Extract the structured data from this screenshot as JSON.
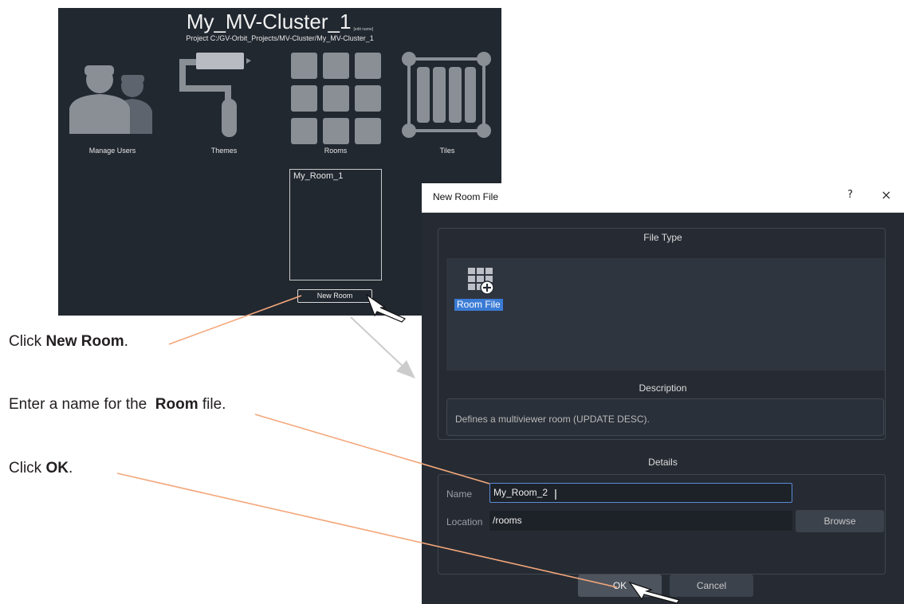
{
  "app": {
    "title": "My_MV-Cluster_1",
    "edit_name": "[edit name]",
    "project_path": "Project C:/GV-Orbit_Projects/MV-Cluster/My_MV-Cluster_1",
    "tiles": [
      {
        "label": "Manage Users",
        "icon": "users-icon"
      },
      {
        "label": "Themes",
        "icon": "paint-roller-icon"
      },
      {
        "label": "Rooms",
        "icon": "grid-icon"
      },
      {
        "label": "Tiles",
        "icon": "tiles-icon"
      }
    ],
    "rooms": [
      "My_Room_1"
    ],
    "new_room_label": "New Room",
    "bg_color": "#222830"
  },
  "instructions": [
    {
      "prefix": "Click ",
      "bold": "New Room",
      "suffix": "."
    },
    {
      "prefix": "Enter a name for the  ",
      "bold": "Room",
      "suffix": " file."
    },
    {
      "prefix": "Click ",
      "bold": "OK",
      "suffix": "."
    }
  ],
  "dialog": {
    "title": "New Room File",
    "help": "?",
    "close": "×",
    "file_type_heading": "File Type",
    "file_types": [
      {
        "label": "Room File",
        "icon": "room-file-icon",
        "selected": true
      }
    ],
    "description_heading": "Description",
    "description": "Defines a multiviewer room (UPDATE DESC).",
    "details_heading": "Details",
    "name_label": "Name",
    "name_value": "My_Room_2",
    "location_label": "Location",
    "location_value": "/rooms",
    "browse_label": "Browse",
    "ok_label": "OK",
    "cancel_label": "Cancel",
    "accent_color": "#3a7bd5"
  },
  "callout_color": "#f4a77a"
}
